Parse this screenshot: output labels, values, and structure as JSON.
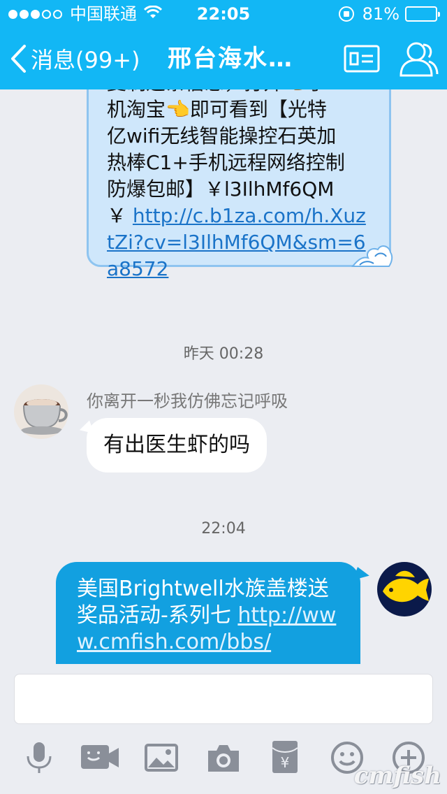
{
  "status": {
    "carrier": "中国联通",
    "time": "22:05",
    "battery": "81%",
    "battery_level": 0.81
  },
  "nav": {
    "back_label": "消息(99+)",
    "title": "邢台海水…"
  },
  "messages": {
    "prev_bubble_lines": [
      "复制这条信息，打开👈手",
      "机淘宝👈即可看到【光特",
      "亿wifi无线智能操控石英加",
      "热棒C1+手机远程网络控制",
      "防爆包邮】￥l3IlhMf6QM"
    ],
    "prev_bubble_yen": "￥",
    "prev_bubble_link": "http://c.b1za.com/h.XuztZi?cv=l3IlhMf6QM&sm=6a8572",
    "time1": "昨天 00:28",
    "sender_name": "你离开一秒我仿佛忘记呼吸",
    "sender_message": "有出医生虾的吗",
    "time2": "22:04",
    "my_message_text": "美国Brightwell水族盖楼送奖品活动-系列七 ",
    "my_message_link": "http://www.cmfish.com/bbs/"
  },
  "input": {
    "placeholder": ""
  },
  "toolbar": {
    "icons": [
      "microphone-icon",
      "video-call-icon",
      "image-icon",
      "camera-icon",
      "red-packet-icon",
      "emoji-icon",
      "plus-icon"
    ]
  },
  "watermark": "cmfish"
}
